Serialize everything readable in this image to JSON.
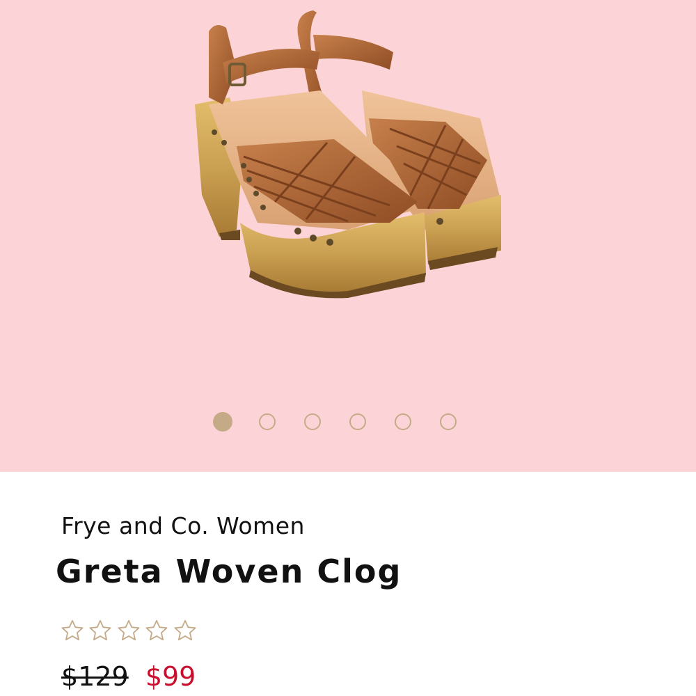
{
  "product": {
    "brand": "Frye and Co. Women",
    "name": "Greta Woven Clog",
    "rating_stars_total": 5,
    "rating_stars_filled": 0,
    "price_original": "$129",
    "price_sale": "$99"
  },
  "gallery": {
    "image_icon": "sandal-clog-photo",
    "image_count": 6,
    "active_index": 0
  },
  "colors": {
    "hero_background": "#fcd4d8",
    "dot_accent": "#c4aa86",
    "sale_price": "#c8102e",
    "star_outline": "#c4aa86"
  }
}
